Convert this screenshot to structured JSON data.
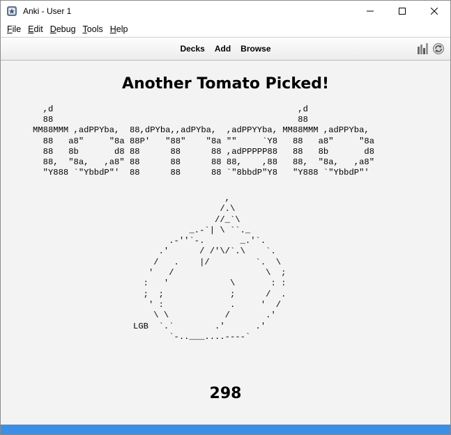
{
  "window": {
    "title": "Anki - User 1"
  },
  "menubar": {
    "items": [
      {
        "first": "F",
        "rest": "ile"
      },
      {
        "first": "E",
        "rest": "dit"
      },
      {
        "first": "D",
        "rest": "ebug"
      },
      {
        "first": "T",
        "rest": "ools"
      },
      {
        "first": "H",
        "rest": "elp"
      }
    ]
  },
  "toolbar": {
    "decks": "Decks",
    "add": "Add",
    "browse": "Browse",
    "icons": [
      "stats-icon",
      "sync-icon"
    ]
  },
  "main": {
    "heading": "Another Tomato Picked!",
    "banner_ascii": "  ,d                                                ,d\n  88                                                88\nMM88MMM ,adPPYba,  88,dPYba,,adPYba,  ,adPPYYba, MM88MMM ,adPPYba,\n  88   a8\"     \"8a 88P'   \"88\"    \"8a \"\"     `Y8   88   a8\"     \"8a\n  88   8b       d8 88      88      88 ,adPPPPP88   88   8b       d8\n  88,  \"8a,   ,a8\" 88      88      88 88,    ,88   88,  \"8a,   ,a8\"\n  \"Y888 `\"YbbdP\"'  88      88      88 `\"8bbdP\"Y8   \"Y888 `\"YbbdP\"'",
    "tomato_ascii": "                  ,\n                 /.\\\n                //_`\\\n           _.-`| \\ ``._\n       .-''`-.       _.'`.\n     .'      / /'\\/`.\\    `.\n    /   .    |/         `.  \\\n   '   /                  \\  ;\n  :   '            \\       : :\n  ;  ;             ;      /  .\n   ' :             .     '  /\n    \\ \\           /       .'\nLGB  `.`        .'      .'\n       `-..___....----`",
    "count": "298"
  },
  "colors": {
    "accent_bar": "#3d8ee6",
    "background": "#f3f3f3"
  }
}
